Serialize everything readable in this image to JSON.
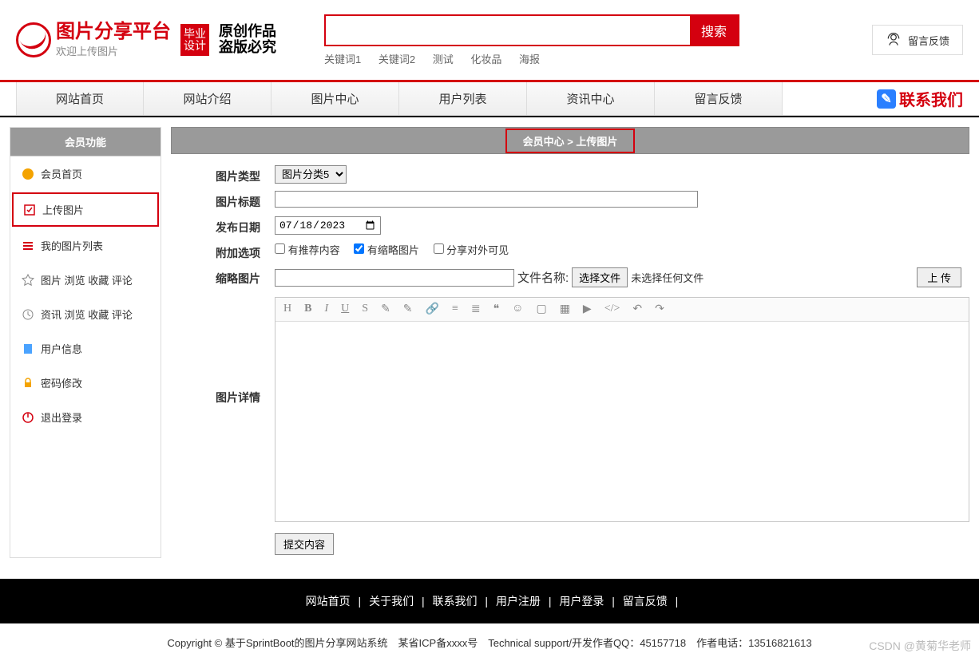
{
  "header": {
    "site_title": "图片分享平台",
    "welcome": "欢迎上传图片",
    "badge": "毕业设计",
    "calig1": "原创作品",
    "calig2": "盗版必究",
    "search_btn": "搜索",
    "keywords": [
      "关键词1",
      "关键词2",
      "测试",
      "化妆品",
      "海报"
    ],
    "feedback": "留言反馈"
  },
  "nav": {
    "items": [
      "网站首页",
      "网站介绍",
      "图片中心",
      "用户列表",
      "资讯中心",
      "留言反馈"
    ],
    "contact": "联系我们"
  },
  "sidebar": {
    "title": "会员功能",
    "items": [
      {
        "label": "会员首页"
      },
      {
        "label": "上传图片"
      },
      {
        "label": "我的图片列表"
      },
      {
        "label": "图片 浏览 收藏 评论"
      },
      {
        "label": "资讯 浏览 收藏 评论"
      },
      {
        "label": "用户信息"
      },
      {
        "label": "密码修改"
      },
      {
        "label": "退出登录"
      }
    ]
  },
  "breadcrumb": "会员中心 > 上传图片",
  "form": {
    "type_label": "图片类型",
    "type_value": "图片分类5",
    "title_label": "图片标题",
    "date_label": "发布日期",
    "date_value": "2023/07/18",
    "extra_label": "附加选项",
    "chk1": "有推荐内容",
    "chk2": "有缩略图片",
    "chk3": "分享对外可见",
    "thumb_label": "缩略图片",
    "file_label": "文件名称:",
    "file_btn": "选择文件",
    "file_status": "未选择任何文件",
    "upload_small": "上 传",
    "detail_label": "图片详情",
    "submit": "提交内容"
  },
  "footer": {
    "links": [
      "网站首页",
      "关于我们",
      "联系我们",
      "用户注册",
      "用户登录",
      "留言反馈"
    ],
    "copyright": "Copyright © 基于SprintBoot的图片分享网站系统　某省ICP备xxxx号　Technical support/开发作者QQ：45157718　作者电话：13516821613"
  },
  "csdn": "CSDN @黄菊华老师"
}
